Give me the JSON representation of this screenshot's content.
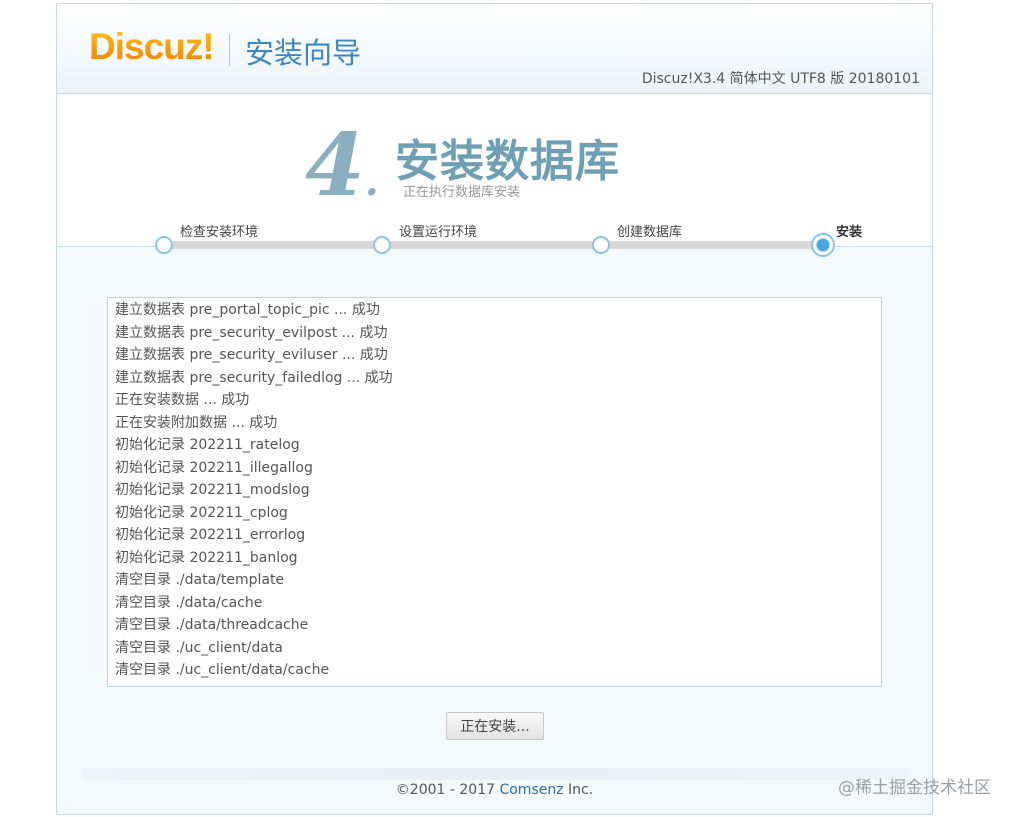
{
  "header": {
    "logo_text": "Discuz!",
    "wizard_title": "安装向导",
    "version": "Discuz!X3.4 简体中文 UTF8 版 20180101"
  },
  "step": {
    "number": "4",
    "title": "安装数据库",
    "subtitle": "正在执行数据库安装"
  },
  "progress": {
    "steps": [
      {
        "label": "检查安装环境"
      },
      {
        "label": "设置运行环境"
      },
      {
        "label": "创建数据库"
      },
      {
        "label": "安装"
      }
    ],
    "current_index": 3
  },
  "log": {
    "lines": [
      "建立数据表 pre_portal_topic_pic ... 成功",
      "建立数据表 pre_security_evilpost ... 成功",
      "建立数据表 pre_security_eviluser ... 成功",
      "建立数据表 pre_security_failedlog ... 成功",
      "正在安装数据 ... 成功",
      "正在安装附加数据 ... 成功",
      "初始化记录 202211_ratelog",
      "初始化记录 202211_illegallog",
      "初始化记录 202211_modslog",
      "初始化记录 202211_cplog",
      "初始化记录 202211_errorlog",
      "初始化记录 202211_banlog",
      "清空目录 ./data/template",
      "清空目录 ./data/cache",
      "清空目录 ./data/threadcache",
      "清空目录 ./uc_client/data",
      "清空目录 ./uc_client/data/cache"
    ]
  },
  "button": {
    "label": "正在安装..."
  },
  "footer": {
    "copyright_prefix": "©2001 - 2017 ",
    "company_link": "Comsenz",
    "copyright_suffix": " Inc."
  },
  "watermark": "@稀土掘金技术社区",
  "colors": {
    "accent": "#3d86c0",
    "logo_orange": "#f39800",
    "step_title": "#6f9fb2"
  }
}
